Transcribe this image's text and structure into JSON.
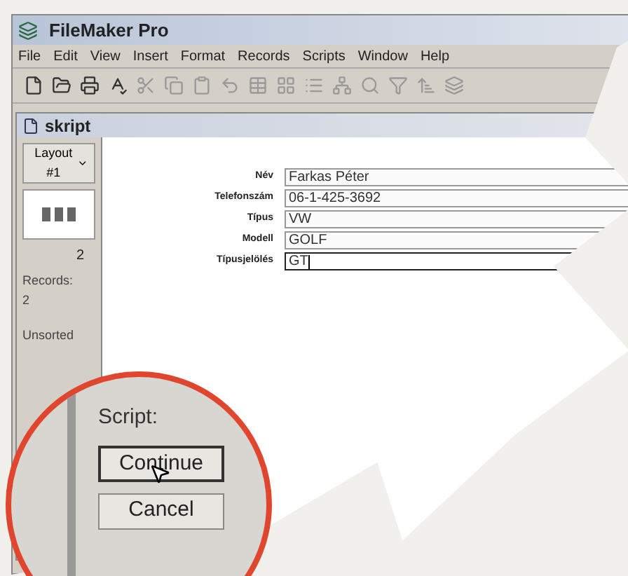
{
  "window": {
    "title": "FileMaker Pro"
  },
  "menu": [
    "File",
    "Edit",
    "View",
    "Insert",
    "Format",
    "Records",
    "Scripts",
    "Window",
    "Help"
  ],
  "document": {
    "title": "skript"
  },
  "status_area": {
    "layout": "Layout #1",
    "record_number": "2",
    "records_label": "Records:",
    "records_count": "2",
    "sort_state": "Unsorted"
  },
  "fields": [
    {
      "label": "Név",
      "value": "Farkas Péter",
      "focused": false
    },
    {
      "label": "Telefonszám",
      "value": "06-1-425-3692",
      "focused": false
    },
    {
      "label": "Típus",
      "value": "VW",
      "focused": false
    },
    {
      "label": "Modell",
      "value": "GOLF",
      "focused": false
    },
    {
      "label": "Típusjelölés",
      "value": "GT",
      "focused": true
    }
  ],
  "magnifier": {
    "label": "Script:",
    "buttons": [
      {
        "label": "Continue",
        "hovered": true
      },
      {
        "label": "Cancel",
        "hovered": false
      }
    ]
  }
}
